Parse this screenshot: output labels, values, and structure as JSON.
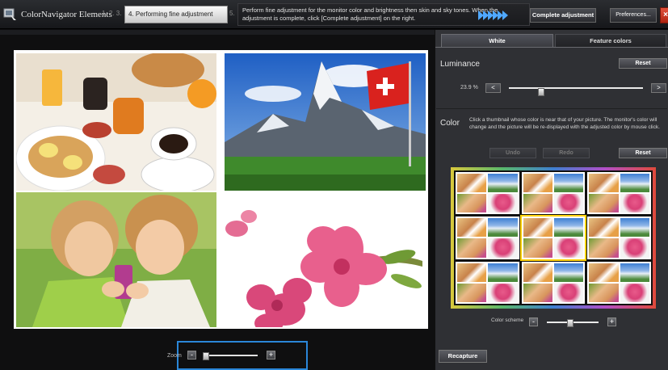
{
  "app": {
    "title": "ColorNavigator Elements",
    "steps_done": "1. 2. 3.",
    "current_step": "4. Performing fine adjustment",
    "next_step": "5.",
    "instruction": "Perform fine adjustment for the monitor color and brightness then skin and sky tones. When the adjustment is complete, click [Complete adjustment] on the right.",
    "complete_button": "Complete adjustment",
    "preferences_button": "Preferences...",
    "close_button": "×"
  },
  "preview": {
    "zoom_label": "Zoom",
    "zoom_minus": "-",
    "zoom_plus": "+",
    "zoom_level": 0.05
  },
  "panel": {
    "tabs": [
      {
        "label": "White",
        "active": true
      },
      {
        "label": "Feature colors",
        "active": false
      }
    ],
    "luminance": {
      "title": "Luminance",
      "reset": "Reset",
      "value": "23.9 %",
      "minus": "<",
      "plus": ">",
      "slider_level": 0.239
    },
    "color": {
      "title": "Color",
      "description": "Click a thumbnail whose color is near that of your picture. The monitor's color will change and the picture will be re-displayed with the adjusted color by mouse click.",
      "undo": "Undo",
      "redo": "Redo",
      "reset": "Reset",
      "scheme_label": "Color scheme",
      "scheme_minus": "-",
      "scheme_plus": "+",
      "scheme_level": 0.45
    },
    "recapture": "Recapture"
  },
  "colors": {
    "accent": "#2a86d8",
    "panel": "#323337",
    "close": "#d0391f"
  }
}
